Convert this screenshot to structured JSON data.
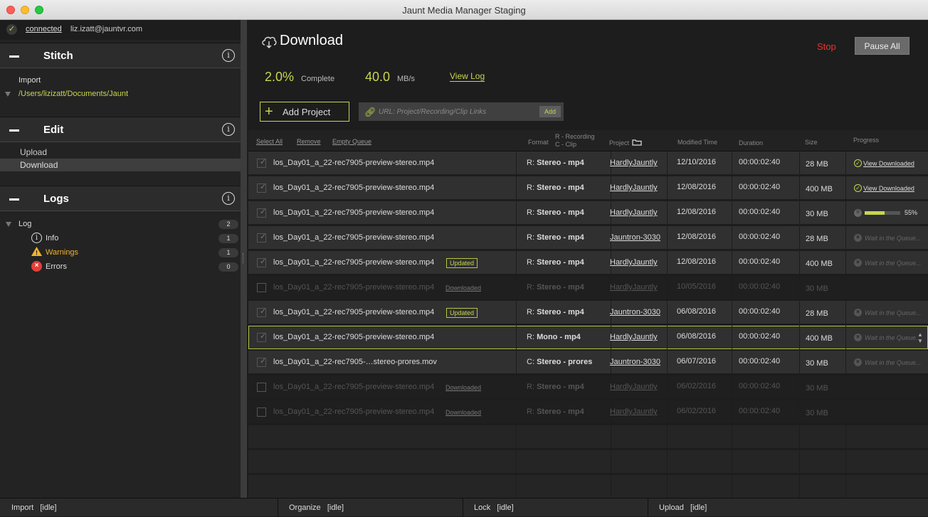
{
  "window": {
    "title": "Jaunt Media Manager Staging"
  },
  "connection": {
    "status": "connected",
    "email": "liz.izatt@jauntvr.com"
  },
  "sections": {
    "stitch": "Stitch",
    "edit": "Edit",
    "logs": "Logs"
  },
  "stitch": {
    "import_label": "Import",
    "path": "/Users/lizizatt/Documents/Jaunt"
  },
  "edit": {
    "items": [
      "Upload",
      "Download"
    ],
    "active": "Download"
  },
  "logs": {
    "root": {
      "label": "Log",
      "count": "2"
    },
    "items": [
      {
        "label": "Info",
        "count": "1",
        "icon": "info-icon"
      },
      {
        "label": "Warnings",
        "count": "1",
        "icon": "warning-icon"
      },
      {
        "label": "Errors",
        "count": "0",
        "icon": "error-icon"
      }
    ]
  },
  "colors": {
    "accent": "#c7d64e",
    "stop": "#e8352b",
    "error": "#e0403a",
    "warning": "#f0b429"
  },
  "main": {
    "title": "Download",
    "stop_label": "Stop",
    "pause_label": "Pause All",
    "complete_value": "2.0%",
    "complete_label": "Complete",
    "speed_value": "40.0",
    "speed_unit": "MB/s",
    "view_log": "View Log",
    "add_project": "Add Project",
    "url_placeholder": "URL: Project/Recording/Clip Links",
    "url_add": "Add"
  },
  "table": {
    "actions": {
      "select_all": "Select All",
      "remove": "Remove",
      "empty_queue": "Empty Queue"
    },
    "headers": {
      "format": "Format",
      "format_hint_1": "R - Recording",
      "format_hint_2": "C - Clip",
      "project": "Project",
      "modified": "Modified Time",
      "duration": "Duration",
      "size": "Size",
      "progress": "Progress"
    },
    "rows": [
      {
        "name": "los_Day01_a_22-rec7905-preview-stereo.mp4",
        "badge": "",
        "fmt_prefix": "R:",
        "fmt": "Stereo - mp4",
        "project": "HardlyJauntly",
        "modified": "12/10/2016",
        "duration": "00:00:02:40",
        "size": "28 MB",
        "state": "downloaded",
        "progress_text": "View Downloaded",
        "dim": false,
        "selected": false
      },
      {
        "name": "los_Day01_a_22-rec7905-preview-stereo.mp4",
        "badge": "",
        "fmt_prefix": "R:",
        "fmt": "Stereo - mp4",
        "project": "HardlyJauntly",
        "modified": "12/08/2016",
        "duration": "00:00:02:40",
        "size": "400 MB",
        "state": "downloaded",
        "progress_text": "View Downloaded",
        "dim": false,
        "selected": false
      },
      {
        "name": "los_Day01_a_22-rec7905-preview-stereo.mp4",
        "badge": "",
        "fmt_prefix": "R:",
        "fmt": "Stereo - mp4",
        "project": "HardlyJauntly",
        "modified": "12/08/2016",
        "duration": "00:00:02:40",
        "size": "30 MB",
        "state": "progress",
        "progress_text": "55%",
        "progress": 0.55,
        "dim": false,
        "selected": false
      },
      {
        "name": "los_Day01_a_22-rec7905-preview-stereo.mp4",
        "badge": "",
        "fmt_prefix": "R:",
        "fmt": "Stereo - mp4",
        "project": "Jauntron-3030",
        "modified": "12/08/2016",
        "duration": "00:00:02:40",
        "size": "28 MB",
        "state": "wait",
        "progress_text": "Wait in the Queue...",
        "dim": false,
        "selected": false
      },
      {
        "name": "los_Day01_a_22-rec7905-preview-stereo.mp4",
        "badge": "Updated",
        "fmt_prefix": "R:",
        "fmt": "Stereo - mp4",
        "project": "HardlyJauntly",
        "modified": "12/08/2016",
        "duration": "00:00:02:40",
        "size": "400 MB",
        "state": "wait",
        "progress_text": "Wait in the Queue...",
        "dim": false,
        "selected": false
      },
      {
        "name": "los_Day01_a_22-rec7905-preview-stereo.mp4",
        "badge": "Downloaded",
        "fmt_prefix": "R:",
        "fmt": "Stereo - mp4",
        "project": "HardlyJauntly",
        "modified": "10/05/2016",
        "duration": "00:00:02:40",
        "size": "30 MB",
        "state": "none",
        "progress_text": "",
        "dim": true,
        "selected": false
      },
      {
        "name": "los_Day01_a_22-rec7905-preview-stereo.mp4",
        "badge": "Updated",
        "fmt_prefix": "R:",
        "fmt": "Stereo - mp4",
        "project": "Jauntron-3030",
        "modified": "06/08/2016",
        "duration": "00:00:02:40",
        "size": "28 MB",
        "state": "wait",
        "progress_text": "Wait in the Queue...",
        "dim": false,
        "selected": false
      },
      {
        "name": "los_Day01_a_22-rec7905-preview-stereo.mp4",
        "badge": "",
        "fmt_prefix": "R:",
        "fmt": "Mono - mp4",
        "project": "HardlyJauntly",
        "modified": "06/08/2016",
        "duration": "00:00:02:40",
        "size": "400 MB",
        "state": "wait",
        "progress_text": "Wait in the Queue...",
        "dim": false,
        "selected": true
      },
      {
        "name": "los_Day01_a_22-rec7905-…stereo-prores.mov",
        "badge": "",
        "fmt_prefix": "C:",
        "fmt": "Stereo - prores",
        "project": "Jauntron-3030",
        "modified": "06/07/2016",
        "duration": "00:00:02:40",
        "size": "30 MB",
        "state": "wait",
        "progress_text": "Wait in the Queue...",
        "dim": false,
        "selected": false
      },
      {
        "name": "los_Day01_a_22-rec7905-preview-stereo.mp4",
        "badge": "Downloaded",
        "fmt_prefix": "R:",
        "fmt": "Stereo - mp4",
        "project": "HardlyJauntly",
        "modified": "06/02/2016",
        "duration": "00:00:02:40",
        "size": "30 MB",
        "state": "none",
        "progress_text": "",
        "dim": true,
        "selected": false
      },
      {
        "name": "los_Day01_a_22-rec7905-preview-stereo.mp4",
        "badge": "Downloaded",
        "fmt_prefix": "R:",
        "fmt": "Stereo - mp4",
        "project": "HardlyJauntly",
        "modified": "06/02/2016",
        "duration": "00:00:02:40",
        "size": "30 MB",
        "state": "none",
        "progress_text": "",
        "dim": true,
        "selected": false
      }
    ]
  },
  "statusbar": [
    {
      "label": "Import",
      "state": "[idle]"
    },
    {
      "label": "Organize",
      "state": "[idle]"
    },
    {
      "label": "Lock",
      "state": "[idle]"
    },
    {
      "label": "Upload",
      "state": "[idle]"
    }
  ]
}
